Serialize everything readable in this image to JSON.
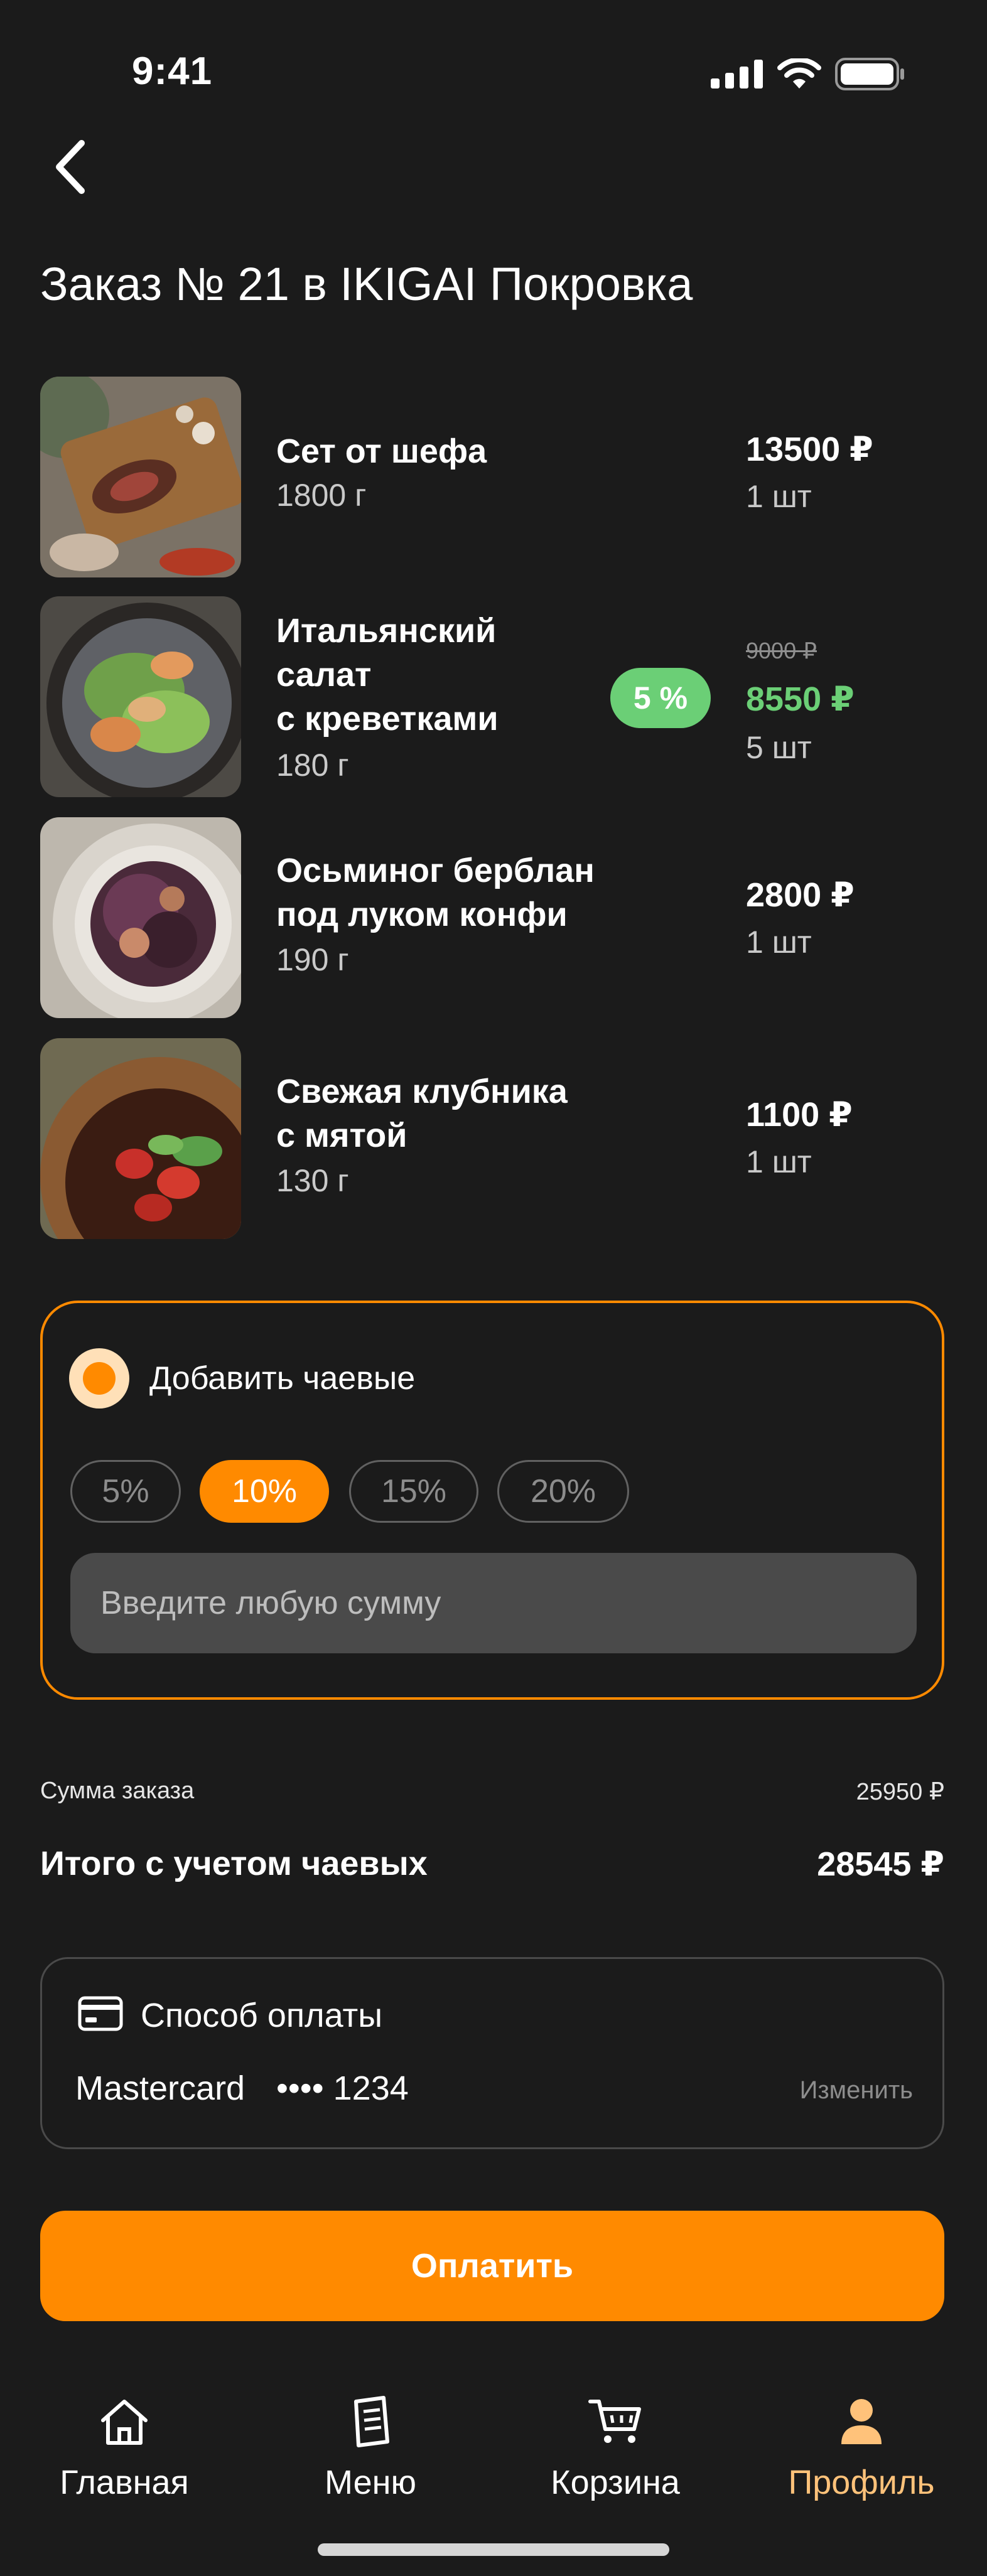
{
  "status_bar": {
    "time": "9:41"
  },
  "header": {
    "title": "Заказ № 21 в IKIGAI Покровка"
  },
  "items": [
    {
      "name_lines": [
        "Сет от шефа"
      ],
      "weight": "1800 г",
      "price": "13500 ₽",
      "qty": "1 шт"
    },
    {
      "name_lines": [
        "Итальянский",
        "салат",
        "с креветками"
      ],
      "weight": "180 г",
      "discount": "5 %",
      "old_price": "9000 ₽",
      "price": "8550 ₽",
      "qty": "5 шт"
    },
    {
      "name_lines": [
        "Осьминог берблан",
        "под луком конфи"
      ],
      "weight": "190 г",
      "price": "2800 ₽",
      "qty": "1 шт"
    },
    {
      "name_lines": [
        "Свежая клубника",
        "с мятой"
      ],
      "weight": "130 г",
      "price": "1100 ₽",
      "qty": "1 шт"
    }
  ],
  "tips": {
    "label": "Добавить чаевые",
    "options": [
      "5%",
      "10%",
      "15%",
      "20%"
    ],
    "selected": "10%",
    "input_placeholder": "Введите любую сумму"
  },
  "totals": {
    "subtotal_label": "Сумма заказа",
    "subtotal_value": "25950 ₽",
    "total_label": "Итого с учетом чаевых",
    "total_value": "28545 ₽"
  },
  "payment": {
    "title": "Способ оплаты",
    "brand": "Mastercard",
    "masked_number": "•••• 1234",
    "change_label": "Изменить"
  },
  "pay_button": "Оплатить",
  "tab_bar": {
    "items": [
      {
        "label": "Главная",
        "icon": "home-icon"
      },
      {
        "label": "Меню",
        "icon": "menu-book-icon"
      },
      {
        "label": "Корзина",
        "icon": "cart-icon"
      },
      {
        "label": "Профиль",
        "icon": "profile-icon"
      }
    ],
    "active": "Профиль"
  },
  "colors": {
    "accent": "#ff8a00",
    "discount": "#6bcf76",
    "background": "#1b1b1b"
  }
}
